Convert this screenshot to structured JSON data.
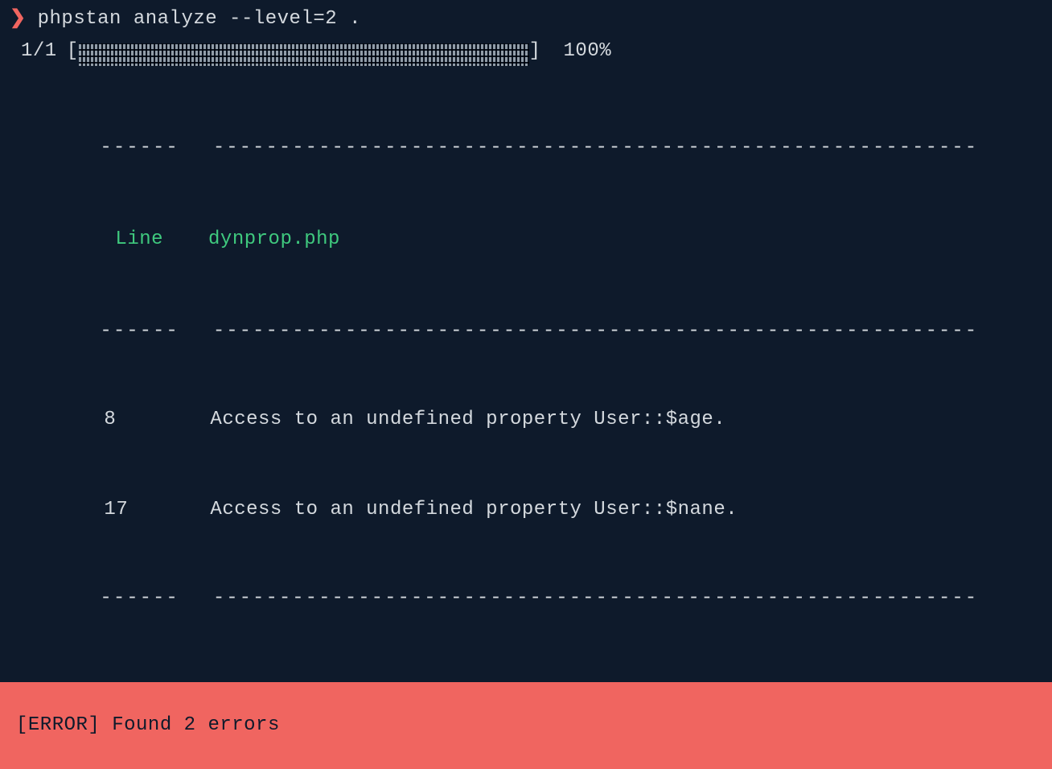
{
  "prompt": {
    "symbol": "❯",
    "command": "phpstan analyze --level=2 ."
  },
  "progress": {
    "count": "1/1",
    "bar_open": "[",
    "bar_close": "]",
    "percent": "100%"
  },
  "table": {
    "divider_top_col1": "------",
    "divider_top_col2": "----------------------------------------------------------",
    "header": {
      "col1": "Line",
      "col2": "dynprop.php"
    },
    "divider_mid_col1": "------",
    "divider_mid_col2": "----------------------------------------------------------",
    "rows": [
      {
        "line": "8",
        "message": "Access to an undefined property User::$age."
      },
      {
        "line": "17",
        "message": "Access to an undefined property User::$nane."
      }
    ],
    "divider_bot_col1": "------",
    "divider_bot_col2": "----------------------------------------------------------"
  },
  "error": {
    "text": "[ERROR] Found 2 errors"
  }
}
